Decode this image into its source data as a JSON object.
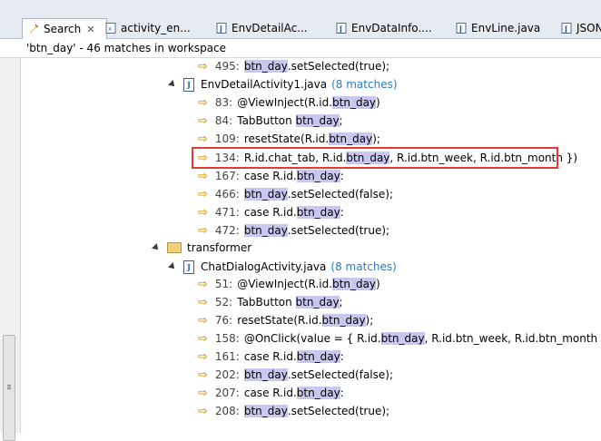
{
  "tabs": [
    {
      "label": "Search",
      "close": "✕"
    },
    {
      "label": "activity_en..."
    },
    {
      "label": "EnvDetailAc..."
    },
    {
      "label": "EnvDataInfo...."
    },
    {
      "label": "EnvLine.java"
    },
    {
      "label": "JSON"
    }
  ],
  "status": "'btn_day' - 46 matches in workspace",
  "tree": {
    "first_line": {
      "num": "495:",
      "pre": "",
      "hit": "btn_day",
      "post": ".setSelected(true);"
    },
    "file1": {
      "name": "EnvDetailActivity1.java",
      "matches": "(8 matches)",
      "lines": [
        {
          "num": "83:",
          "pre": "@ViewInject(R.id.",
          "hit": "btn_day",
          "post": ")"
        },
        {
          "num": "84:",
          "pre": "TabButton ",
          "hit": "btn_day",
          "post": ";"
        },
        {
          "num": "109:",
          "pre": "resetState(R.id.",
          "hit": "btn_day",
          "post": ");"
        },
        {
          "num": "134:",
          "pre": "R.id.chat_tab, R.id.",
          "hit": "btn_day",
          "post": ", R.id.btn_week, R.id.btn_month })"
        },
        {
          "num": "167:",
          "pre": "case R.id.",
          "hit": "btn_day",
          "post": ":"
        },
        {
          "num": "466:",
          "pre": "",
          "hit": "btn_day",
          "post": ".setSelected(false);"
        },
        {
          "num": "471:",
          "pre": "case R.id.",
          "hit": "btn_day",
          "post": ":"
        },
        {
          "num": "472:",
          "pre": "",
          "hit": "btn_day",
          "post": ".setSelected(true);"
        }
      ]
    },
    "package": {
      "name": "transformer"
    },
    "file2": {
      "name": "ChatDialogActivity.java",
      "matches": "(8 matches)",
      "lines": [
        {
          "num": "51:",
          "pre": "@ViewInject(R.id.",
          "hit": "btn_day",
          "post": ")"
        },
        {
          "num": "52:",
          "pre": "TabButton ",
          "hit": "btn_day",
          "post": ";"
        },
        {
          "num": "76:",
          "pre": "resetState(R.id.",
          "hit": "btn_day",
          "post": ");"
        },
        {
          "num": "158:",
          "pre": "@OnClick(value = { R.id.",
          "hit": "btn_day",
          "post": ", R.id.btn_week, R.id.btn_month })"
        },
        {
          "num": "161:",
          "pre": "case R.id.",
          "hit": "btn_day",
          "post": ":"
        },
        {
          "num": "202:",
          "pre": "",
          "hit": "btn_day",
          "post": ".setSelected(false);"
        },
        {
          "num": "207:",
          "pre": "case R.id.",
          "hit": "btn_day",
          "post": ":"
        },
        {
          "num": "208:",
          "pre": "",
          "hit": "btn_day",
          "post": ".setSelected(true);"
        }
      ]
    }
  },
  "icons": {
    "match_arrow": "⇨",
    "accent": "#e53935"
  }
}
